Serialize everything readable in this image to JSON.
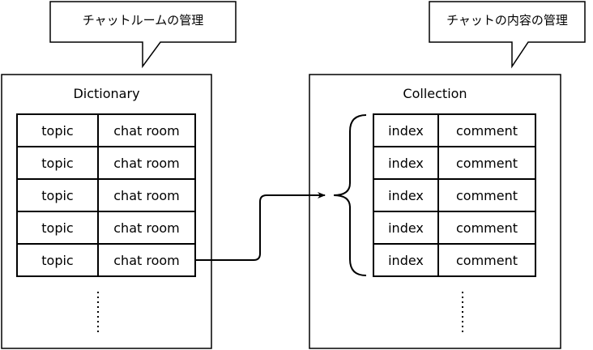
{
  "callouts": {
    "left": "チャットルームの管理",
    "right": "チャットの内容の管理"
  },
  "dictionary": {
    "title": "Dictionary",
    "rows": [
      {
        "key": "topic",
        "value": "chat room"
      },
      {
        "key": "topic",
        "value": "chat room"
      },
      {
        "key": "topic",
        "value": "chat room"
      },
      {
        "key": "topic",
        "value": "chat room"
      },
      {
        "key": "topic",
        "value": "chat room"
      }
    ]
  },
  "collection": {
    "title": "Collection",
    "rows": [
      {
        "key": "index",
        "value": "comment"
      },
      {
        "key": "index",
        "value": "comment"
      },
      {
        "key": "index",
        "value": "comment"
      },
      {
        "key": "index",
        "value": "comment"
      },
      {
        "key": "index",
        "value": "comment"
      }
    ]
  }
}
